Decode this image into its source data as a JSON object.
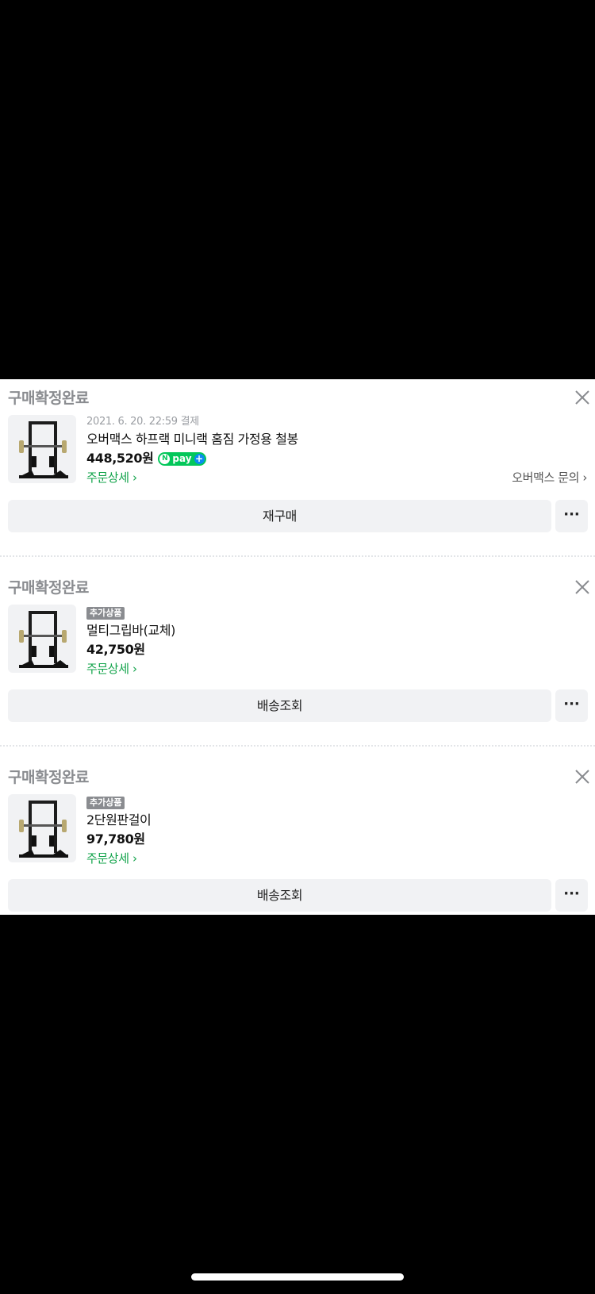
{
  "orders": [
    {
      "status": "구매확정완료",
      "date": "2021. 6. 20. 22:59 결제",
      "badge": "",
      "product_name": "오버맥스 하프랙 미니랙 홈짐 가정용 철봉",
      "price": "448,520원",
      "npay": "pay",
      "detail_link": "주문상세 ›",
      "seller_link": "오버맥스 문의 ›",
      "main_button": "재구매",
      "more_button": "···"
    },
    {
      "status": "구매확정완료",
      "badge": "추가상품",
      "product_name": "멀티그립바(교체)",
      "price": "42,750원",
      "detail_link": "주문상세 ›",
      "main_button": "배송조회",
      "more_button": "···"
    },
    {
      "status": "구매확정완료",
      "badge": "추가상품",
      "product_name": "2단원판걸이",
      "price": "97,780원",
      "detail_link": "주문상세 ›",
      "main_button": "배송조회",
      "more_button": "···"
    }
  ],
  "icons": {
    "close": "close-icon",
    "npay_logo": "npay-plus-logo",
    "thumbnail": "power-rack-image"
  },
  "colors": {
    "accent_green": "#11a34a",
    "npay_green": "#03c75a",
    "status_gray": "#8a8c90",
    "button_bg": "#f1f2f4"
  }
}
